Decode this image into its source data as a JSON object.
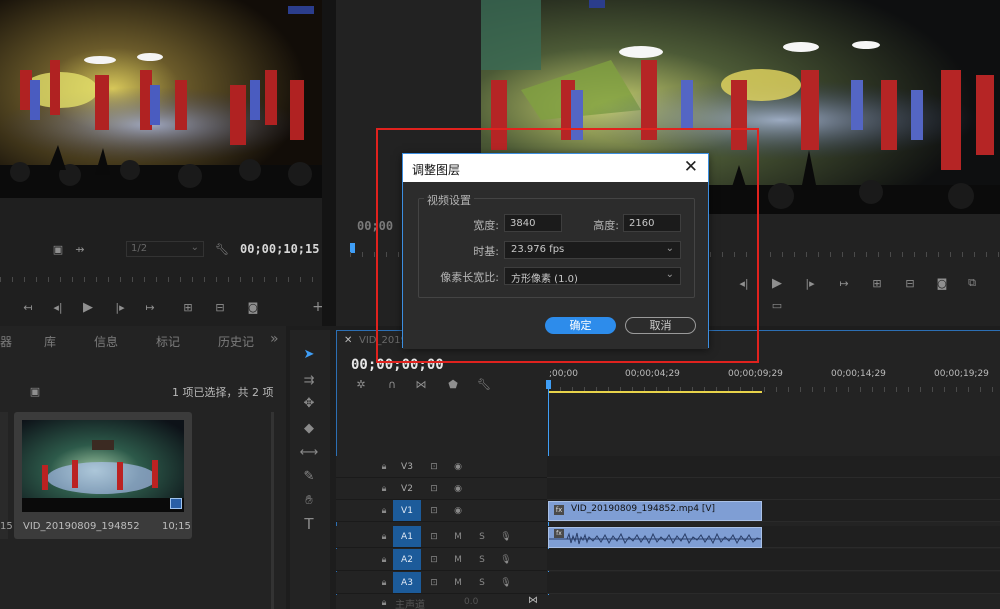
{
  "source_monitor": {
    "timecode": "00;00;10;15",
    "scale": "1/2"
  },
  "program_monitor": {
    "timecode_partial": "00;00"
  },
  "project_panel": {
    "tabs": [
      "库",
      "信息",
      "标记",
      "历史记"
    ],
    "tab_left_fragment": "器",
    "more": "»",
    "selection_status": "1 项已选择，共 2 项",
    "clip": {
      "name": "VID_20190809_194852",
      "duration": "10;15"
    },
    "left_clip_duration_fragment": "15"
  },
  "timeline": {
    "tab_label": "VID_2019",
    "timecode": "00;00;00;00",
    "ruler_labels": [
      ";00;00",
      "00;00;04;29",
      "00;00;09;29",
      "00;00;14;29",
      "00;00;19;29"
    ],
    "video_tracks": [
      "V3",
      "V2",
      "V1"
    ],
    "audio_tracks": [
      "A1",
      "A2",
      "A3"
    ],
    "mute_label": "M",
    "solo_label": "S",
    "master_label": "主声道",
    "master_value": "0.0",
    "video_clip_label": "VID_20190809_194852.mp4 [V]"
  },
  "dialog": {
    "title": "调整图层",
    "close": "✕",
    "group_label": "视频设置",
    "width_label": "宽度:",
    "width_value": "3840",
    "height_label": "高度:",
    "height_value": "2160",
    "timebase_label": "时基:",
    "timebase_value": "23.976 fps",
    "pixel_aspect_label": "像素长宽比:",
    "pixel_aspect_value": "方形像素 (1.0)",
    "ok": "确定",
    "cancel": "取消"
  },
  "colors": {
    "accent": "#2d8ceb",
    "highlight_box": "#e0221e",
    "video_clip": "#7f9ed4",
    "audio_clip": "#7f9ed4",
    "playhead": "#3f9ef6",
    "work_area": "#e8d34a"
  }
}
